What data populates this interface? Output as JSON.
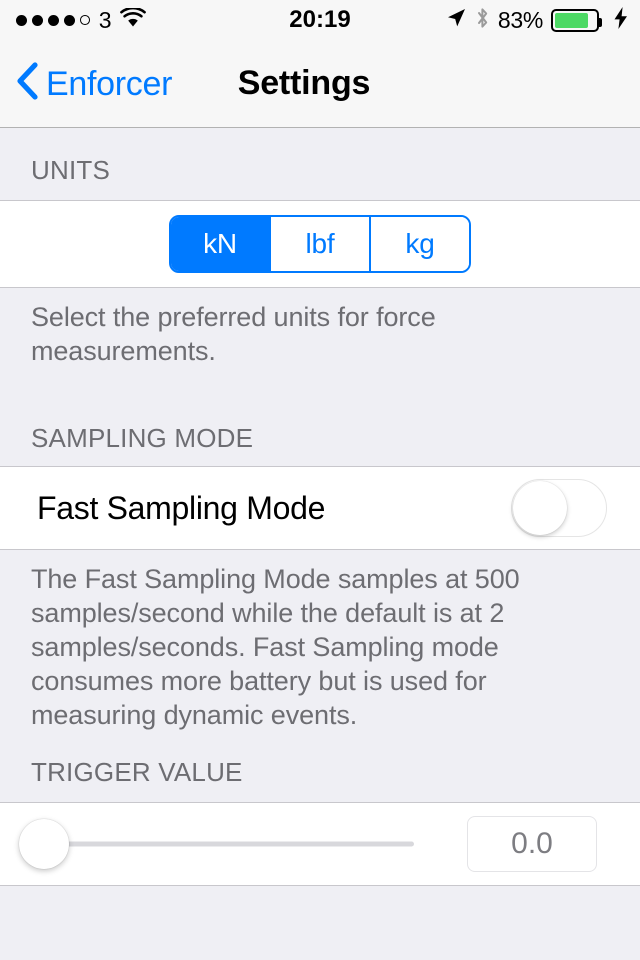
{
  "status_bar": {
    "signal_dots_filled": 4,
    "signal_dots_total": 5,
    "carrier": "3",
    "wifi_icon": "wifi-icon",
    "time": "20:19",
    "location_icon": "location-arrow-icon",
    "bluetooth_icon": "bluetooth-icon",
    "battery_percent": "83%",
    "battery_level": 83,
    "battery_color": "#4cd964",
    "charging_icon": "lightning-bolt-icon"
  },
  "nav_bar": {
    "back_icon": "chevron-left-icon",
    "back_label": "Enforcer",
    "title": "Settings",
    "tint_color": "#007aff"
  },
  "sections": {
    "units": {
      "header": "UNITS",
      "options": [
        "kN",
        "lbf",
        "kg"
      ],
      "selected": "kN",
      "selected_index": 0,
      "footer": "Select the preferred units for force measurements."
    },
    "sampling_mode": {
      "header": "SAMPLING MODE",
      "row_label": "Fast Sampling Mode",
      "toggle_on": false,
      "footer": "The Fast Sampling Mode samples at 500 samples/second while the default is at 2 samples/seconds. Fast Sampling mode consumes more battery but is used for measuring dynamic events."
    },
    "trigger_value": {
      "header": "TRIGGER VALUE",
      "slider_value": 0,
      "slider_min": 0,
      "slider_max": 100,
      "field_value": "0.0"
    }
  },
  "colors": {
    "accent": "#007aff",
    "background": "#efeff4",
    "cell": "#ffffff",
    "separator": "#c8c7cc",
    "secondary_text": "#6d6d72",
    "toggle_on": "#4cd964"
  }
}
